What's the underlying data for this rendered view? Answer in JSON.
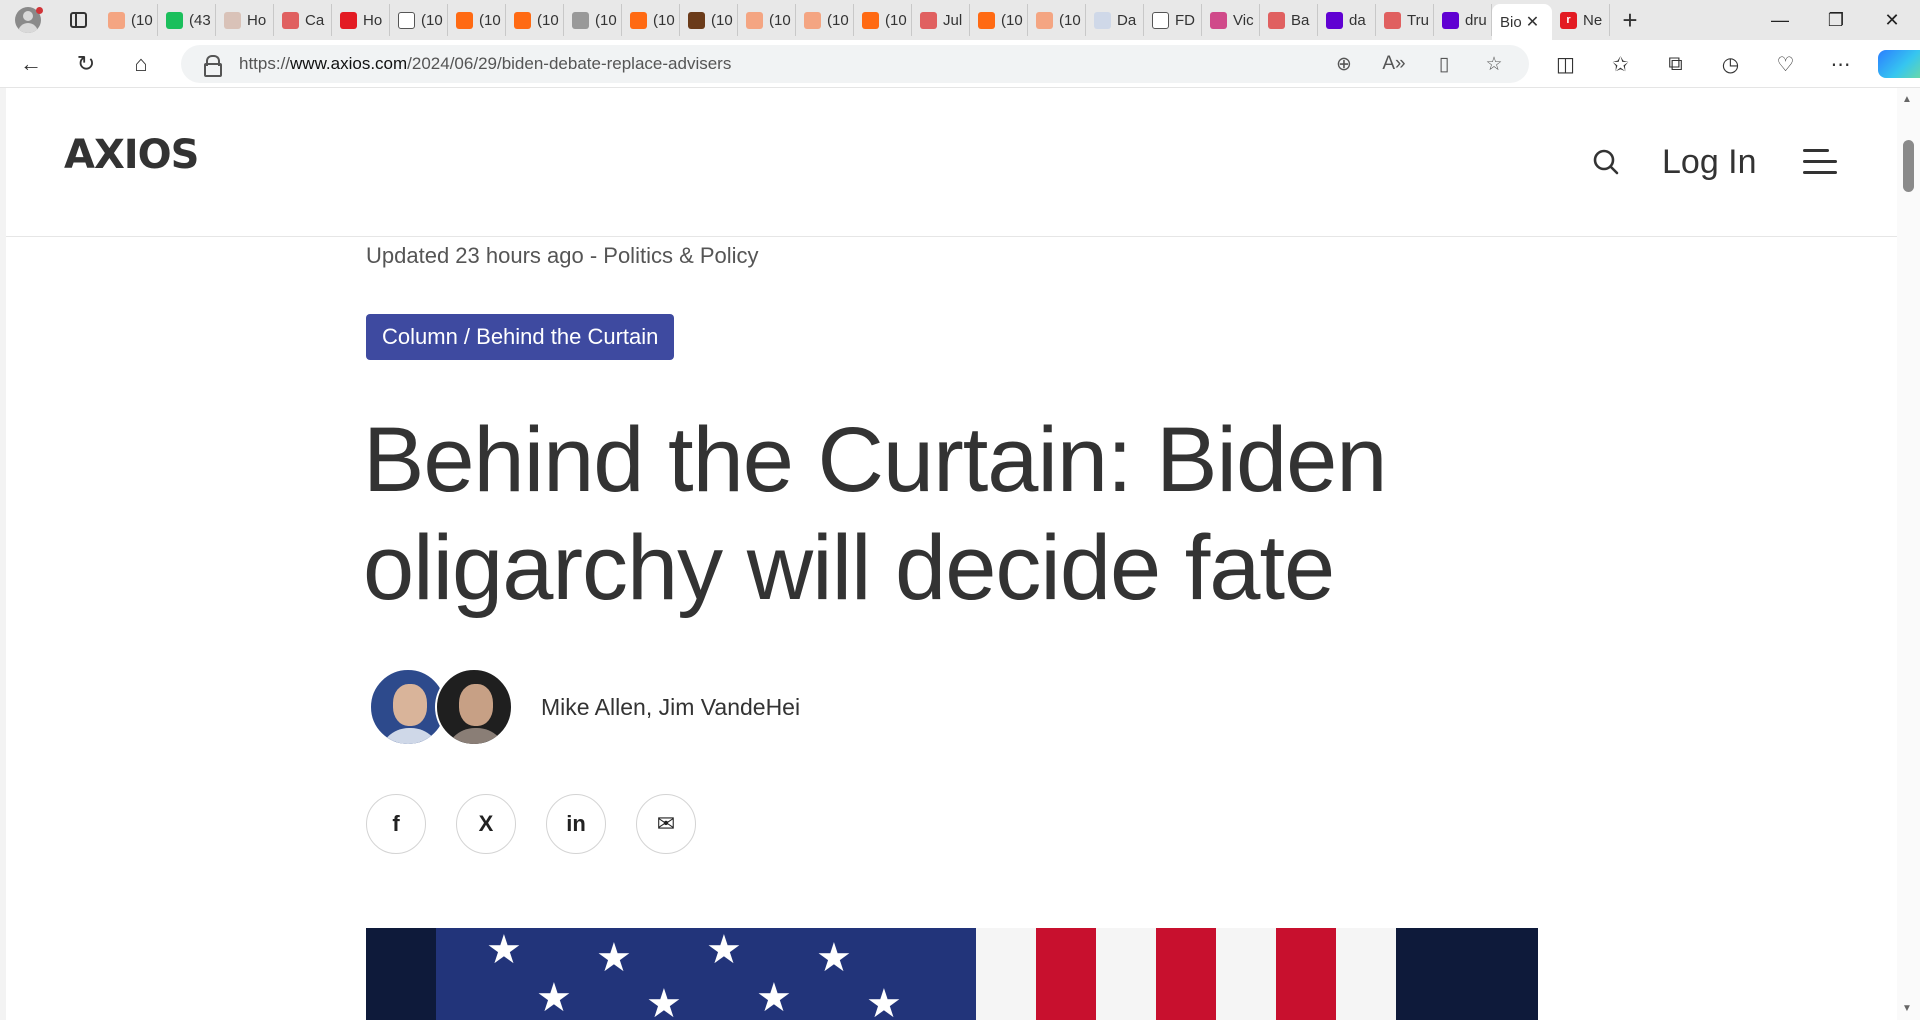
{
  "browser": {
    "tabs": [
      {
        "label": "(10",
        "color": "#f4a582"
      },
      {
        "label": "(43",
        "color": "#1bbf5c"
      },
      {
        "label": "Ho",
        "color": "#d9c2b8"
      },
      {
        "label": "Ca",
        "color": "#e06060"
      },
      {
        "label": "Ho",
        "color": "#e31b23"
      },
      {
        "label": "(10",
        "color": "#ffffff"
      },
      {
        "label": "(10",
        "color": "#ff6a13"
      },
      {
        "label": "(10",
        "color": "#ff6a13"
      },
      {
        "label": "(10",
        "color": "#999999"
      },
      {
        "label": "(10",
        "color": "#ff6a13"
      },
      {
        "label": "(10",
        "color": "#6b3b1a"
      },
      {
        "label": "(10",
        "color": "#f4a582"
      },
      {
        "label": "(10",
        "color": "#f4a582"
      },
      {
        "label": "(10",
        "color": "#ff6a13"
      },
      {
        "label": "Jul",
        "color": "#e06060"
      },
      {
        "label": "(10",
        "color": "#ff6a13"
      },
      {
        "label": "(10",
        "color": "#f4a582"
      },
      {
        "label": "Da",
        "color": "#cfd8e8"
      },
      {
        "label": "FD",
        "color": "#ffffff"
      },
      {
        "label": "Vic",
        "color": "#d04a8a"
      },
      {
        "label": "Ba",
        "color": "#e06060"
      },
      {
        "label": "da",
        "color": "#6001d2"
      },
      {
        "label": "Tru",
        "color": "#e06060"
      },
      {
        "label": "dru",
        "color": "#6001d2"
      }
    ],
    "active_tab": {
      "label": "Bio"
    },
    "last_tab": {
      "label": "Ne",
      "color": "#e31b23"
    },
    "url_prefix": "https://",
    "url_domain": "www.axios.com",
    "url_path": "/2024/06/29/biden-debate-replace-advisers"
  },
  "site": {
    "logo": "AXIOS",
    "login_label": "Log In"
  },
  "article": {
    "meta": "Updated 23 hours ago - Politics & Policy",
    "badge": "Column / Behind the Curtain",
    "headline": "Behind the Curtain: Biden oligarchy will decide fate",
    "authors": "Mike Allen, Jim VandeHei"
  },
  "share": {
    "facebook": "f",
    "x": "X",
    "linkedin": "in",
    "email": "✉"
  }
}
